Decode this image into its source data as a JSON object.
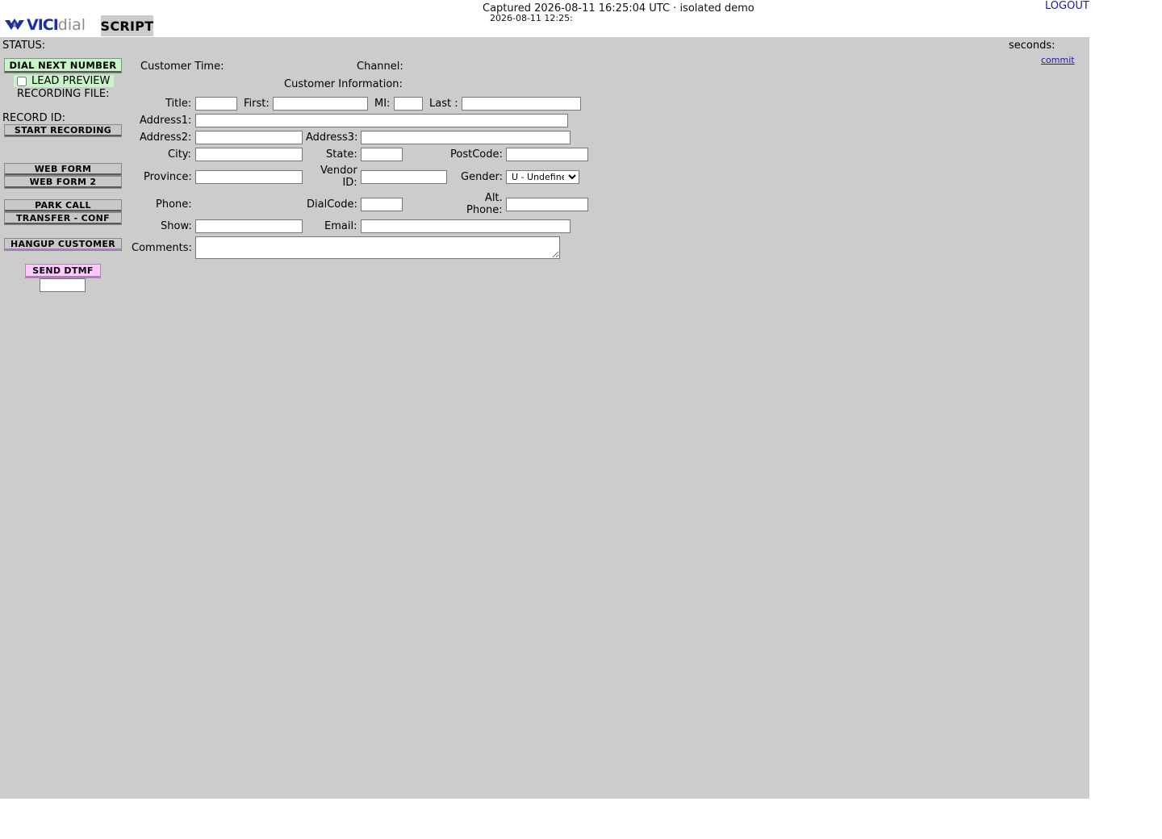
{
  "header": {
    "logo_brand": "VICI",
    "logo_suffix": "dial",
    "script_tab": "SCRIPT",
    "capture_banner": "Captured 2026-08-11 16:25:04 UTC · isolated demo",
    "clock": "2026-08-11 12:25:",
    "logout": "LOGOUT"
  },
  "status_bar": {
    "status_label": "STATUS:",
    "seconds_label": "seconds:",
    "commit_link": "commit"
  },
  "controls": {
    "dial_next": "DIAL NEXT NUMBER",
    "lead_preview": "LEAD PREVIEW",
    "lead_preview_checked": false,
    "recording_file": "RECORDING FILE:",
    "record_id": "RECORD ID:",
    "start_recording": "START RECORDING",
    "web_form": "WEB FORM",
    "web_form_2": "WEB FORM 2",
    "park_call": "PARK CALL",
    "transfer_conf": "TRANSFER - CONF",
    "hangup_customer": "HANGUP CUSTOMER",
    "send_dtmf": "SEND DTMF",
    "dtmf_value": ""
  },
  "customer": {
    "customer_time_label": "Customer Time:",
    "channel_label": "Channel:",
    "info_heading": "Customer Information:",
    "labels": {
      "title": "Title:",
      "first": "First:",
      "mi": "MI:",
      "last": "Last :",
      "address1": "Address1:",
      "address2": "Address2:",
      "address3": "Address3:",
      "city": "City:",
      "state": "State:",
      "postcode": "PostCode:",
      "province": "Province:",
      "vendor_id_1": "Vendor",
      "vendor_id_2": "ID:",
      "gender": "Gender:",
      "phone": "Phone:",
      "dialcode": "DialCode:",
      "alt_phone_1": "Alt.",
      "alt_phone_2": "Phone:",
      "show": "Show:",
      "email": "Email:",
      "comments": "Comments:"
    },
    "values": {
      "title": "",
      "first": "",
      "mi": "",
      "last": "",
      "address1": "",
      "address2": "",
      "address3": "",
      "city": "",
      "state": "",
      "postcode": "",
      "province": "",
      "vendor_id": "",
      "dialcode": "",
      "alt_phone": "",
      "show": "",
      "email": "",
      "comments": ""
    },
    "gender_selected": "U - Undefined"
  },
  "colors": {
    "panel_bg": "#cccccc",
    "dial_button": "#c8f5c8",
    "dtmf_button": "#ffc8ff",
    "link": "#1a1aa6",
    "logo_blue": "#1a2fa6"
  }
}
